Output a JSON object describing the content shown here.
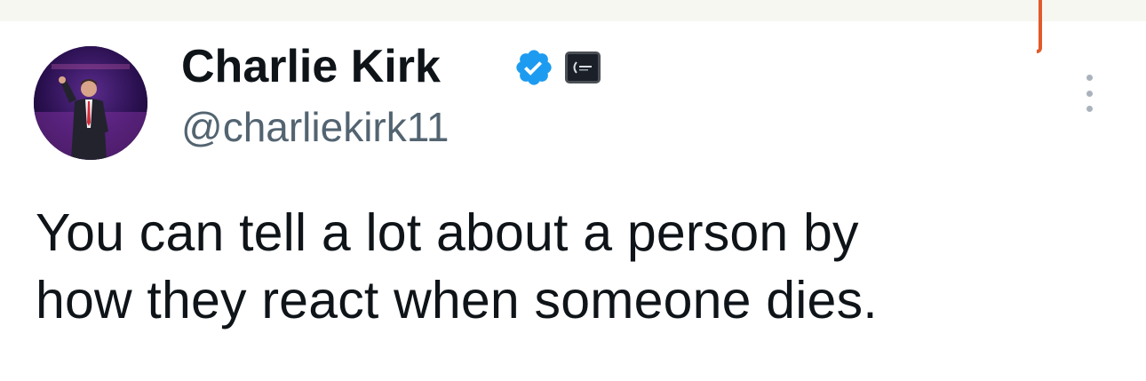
{
  "tweet": {
    "author": {
      "name": "Charlie Kirk",
      "handle": "@charliekirk11",
      "verified": true,
      "avatar_icon": "profile-photo",
      "affiliate_badge_icon": "affiliation-badge-icon"
    },
    "more_icon": "more-vertical-icon",
    "text_lines": [
      "You can tell a lot about a person by",
      "how they react when someone dies."
    ]
  },
  "colors": {
    "verified_blue": "#1d9bf0",
    "primary_text": "#0f1419",
    "secondary_text": "#536471",
    "top_strip": "#f7f7f2",
    "marker_red": "#e25a2b"
  }
}
